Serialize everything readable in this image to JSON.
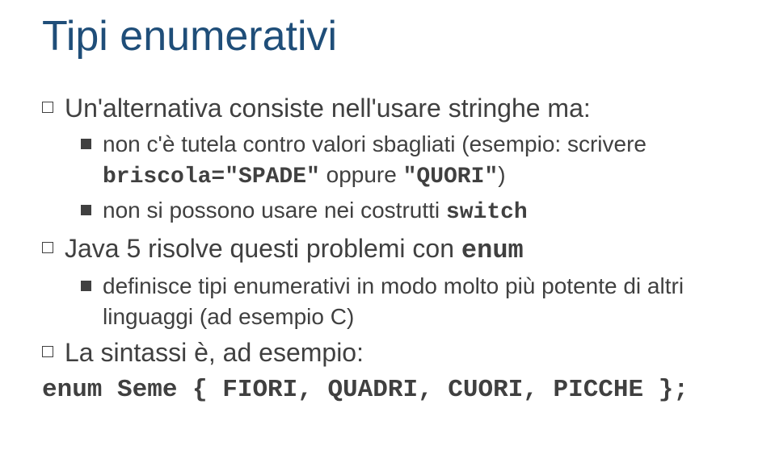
{
  "title": "Tipi enumerativi",
  "bullets": {
    "l1_1_a": "Un'alternativa consiste nell'usare stringhe ma:",
    "l2_1_a": "non c'è tutela contro valori sbagliati (esempio: scrivere ",
    "l2_1_code1": "briscola=\"SPADE\"",
    "l2_1_b": " oppure ",
    "l2_1_code2": "\"QUORI\"",
    "l2_1_c": ")",
    "l2_2_a": "non si possono usare nei costrutti ",
    "l2_2_code": "switch",
    "l1_2_a": "Java 5 risolve questi problemi con ",
    "l1_2_code": "enum",
    "l2_3_a": "definisce tipi enumerativi in modo molto più potente di altri linguaggi (ad esempio C)",
    "l1_3_a": "La sintassi è, ad esempio:",
    "code_line": "enum Seme { FIORI, QUADRI, CUORI, PICCHE };"
  }
}
